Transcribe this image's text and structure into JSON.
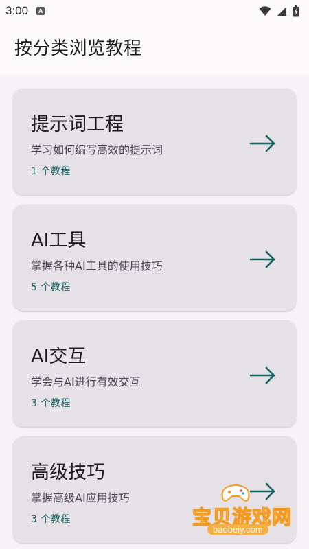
{
  "status_bar": {
    "time": "3:00",
    "icons": [
      "notification-a-icon",
      "wifi-icon",
      "signal-icon",
      "battery-icon"
    ]
  },
  "page": {
    "title": "按分类浏览教程"
  },
  "categories": [
    {
      "title": "提示词工程",
      "description": "学习如何编写高效的提示词",
      "count": "1 个教程"
    },
    {
      "title": "AI工具",
      "description": "掌握各种AI工具的使用技巧",
      "count": "5 个教程"
    },
    {
      "title": "AI交互",
      "description": "学会与AI进行有效交互",
      "count": "3 个教程"
    },
    {
      "title": "高级技巧",
      "description": "掌握高级AI应用技巧",
      "count": "3 个教程"
    }
  ],
  "watermark": {
    "text": "宝贝游戏网",
    "url": "baobeiy.com"
  },
  "colors": {
    "background": "#fdfafc",
    "content_background": "#f6f3f6",
    "card": "#e6e1e6",
    "accent": "#10615e",
    "title_text": "#1c1b1f",
    "secondary_text": "#49454f"
  }
}
